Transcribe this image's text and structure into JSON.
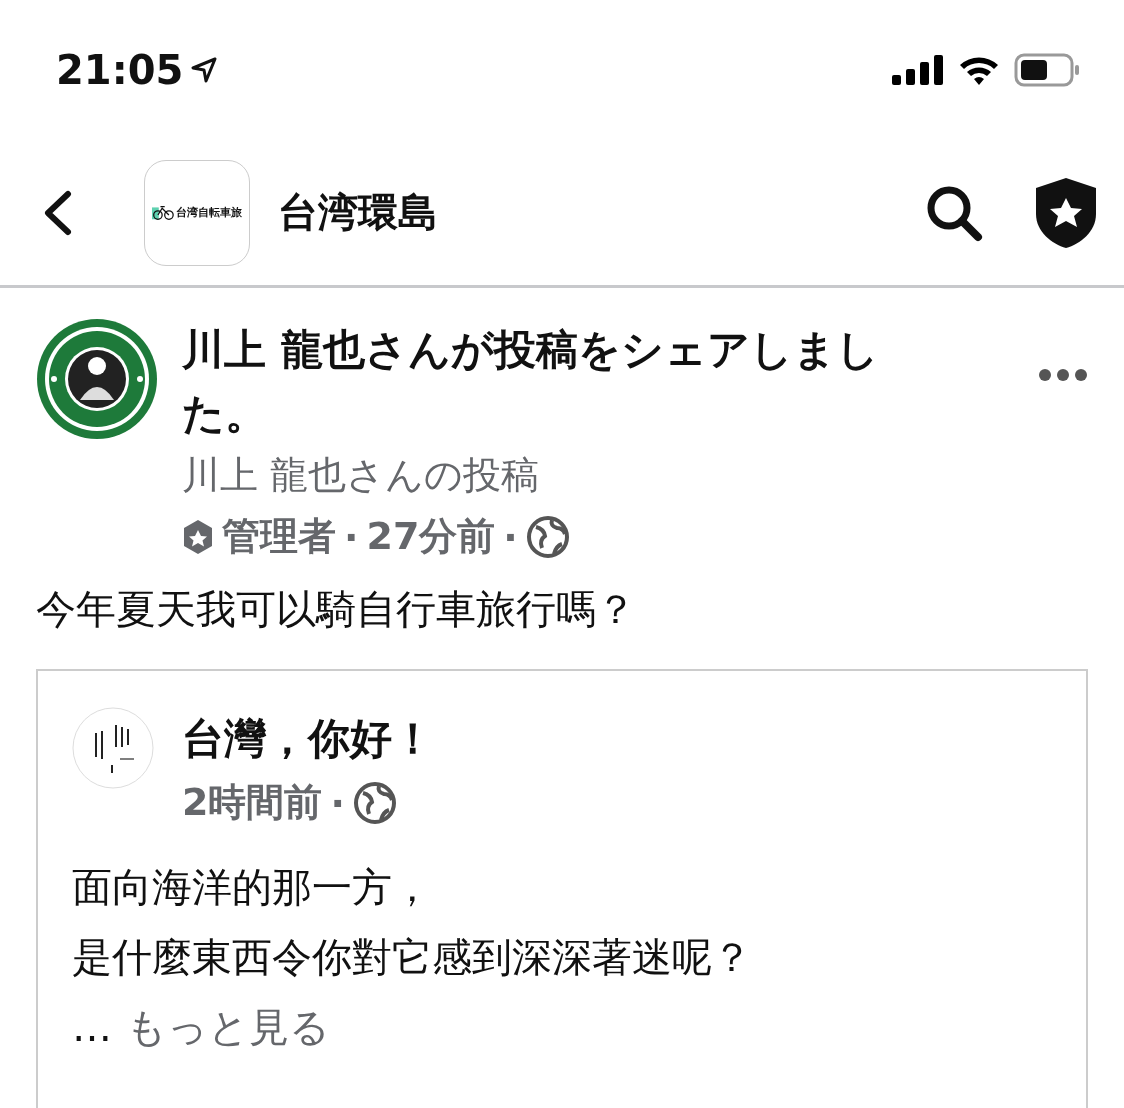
{
  "status_bar": {
    "time": "21:05"
  },
  "header": {
    "group_logo_text": "台湾自転車旅",
    "title": "台湾環島"
  },
  "post": {
    "title": "川上 龍也さんが投稿をシェアしました。",
    "subtitle": "川上 龍也さんの投稿",
    "role": "管理者",
    "time": "27分前",
    "separator": "·",
    "text": "今年夏天我可以騎自行車旅行嗎？",
    "shared": {
      "author": "台灣，你好！",
      "time": "2時間前",
      "separator": "·",
      "lines": [
        "面向海洋的那一方，",
        "是什麼東西令你對它感到深深著迷呢？"
      ],
      "ellipsis": "…",
      "more": "もっと見る"
    }
  }
}
